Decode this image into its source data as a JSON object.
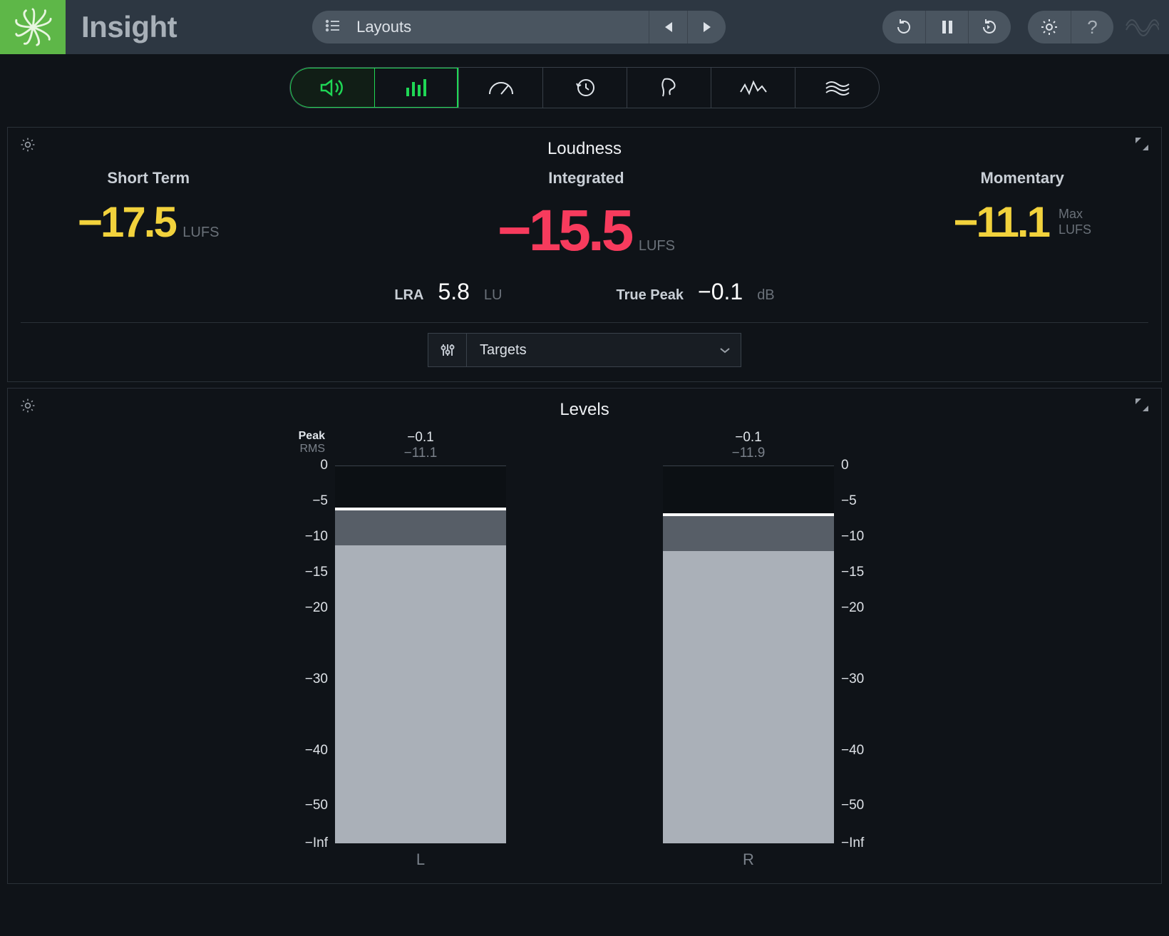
{
  "app": {
    "title": "Insight"
  },
  "layouts": {
    "label": "Layouts"
  },
  "loudness": {
    "panel_title": "Loudness",
    "short_term": {
      "label": "Short Term",
      "value": "−17.5",
      "unit": "LUFS"
    },
    "integrated": {
      "label": "Integrated",
      "value": "−15.5",
      "unit": "LUFS"
    },
    "momentary": {
      "label": "Momentary",
      "value": "−11.1",
      "side1": "Max",
      "side2": "LUFS"
    },
    "lra": {
      "label": "LRA",
      "value": "5.8",
      "unit": "LU"
    },
    "true_peak": {
      "label": "True Peak",
      "value": "−0.1",
      "unit": "dB"
    },
    "targets_label": "Targets"
  },
  "levels": {
    "panel_title": "Levels",
    "peak_label": "Peak",
    "rms_label": "RMS",
    "scale": [
      "0",
      "−5",
      "−10",
      "−15",
      "−20",
      "−30",
      "−40",
      "−50",
      "−Inf"
    ],
    "scale_pct": [
      0,
      9.4,
      18.9,
      28.3,
      37.7,
      56.6,
      75.5,
      90,
      100
    ],
    "channels": [
      {
        "name": "L",
        "peak": "−0.1",
        "rms": "−11.1",
        "peak_line_top_pct": 11.0,
        "mid_top_pct": 11.7,
        "mid_bottom_pct": 20.9,
        "light_top_pct": 20.9
      },
      {
        "name": "R",
        "peak": "−0.1",
        "rms": "−11.9",
        "peak_line_top_pct": 12.5,
        "mid_top_pct": 13.2,
        "mid_bottom_pct": 22.4,
        "light_top_pct": 22.4
      }
    ]
  }
}
